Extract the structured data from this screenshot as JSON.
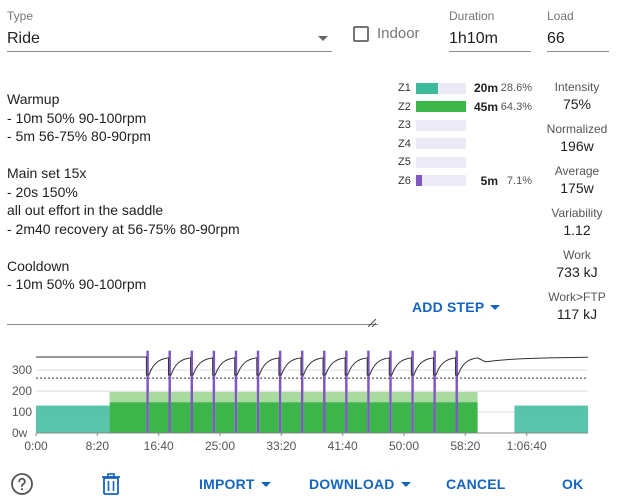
{
  "type_field": {
    "label": "Type",
    "value": "Ride"
  },
  "indoor": {
    "label": "Indoor",
    "checked": false
  },
  "duration_field": {
    "label": "Duration",
    "value": "1h10m"
  },
  "load_field": {
    "label": "Load",
    "value": "66"
  },
  "description": {
    "lines": [
      "Warmup",
      "- 10m 50% 90-100rpm",
      "- 5m 56-75% 80-90rpm",
      "",
      "Main set 15x",
      "- 20s 150%",
      "all out effort in the saddle",
      "- 2m40 recovery at 56-75% 80-90rpm",
      "",
      "Cooldown",
      "- 10m 50% 90-100rpm"
    ]
  },
  "zones": [
    {
      "name": "Z1",
      "time": "20m",
      "pct": "28.6%",
      "fraction": 0.286,
      "color": "#3dba9c"
    },
    {
      "name": "Z2",
      "time": "45m",
      "pct": "64.3%",
      "fraction": 0.643,
      "color": "#3cb54a"
    },
    {
      "name": "Z3",
      "time": "",
      "pct": "",
      "fraction": 0,
      "color": "#e6c200"
    },
    {
      "name": "Z4",
      "time": "",
      "pct": "",
      "fraction": 0,
      "color": "#f08c00"
    },
    {
      "name": "Z5",
      "time": "",
      "pct": "",
      "fraction": 0,
      "color": "#e53935"
    },
    {
      "name": "Z6",
      "time": "5m",
      "pct": "7.1%",
      "fraction": 0.071,
      "color": "#7e57c2"
    }
  ],
  "stats": [
    {
      "label": "Intensity",
      "value": "75%"
    },
    {
      "label": "Normalized",
      "value": "196w"
    },
    {
      "label": "Average",
      "value": "175w"
    },
    {
      "label": "Variability",
      "value": "1.12"
    },
    {
      "label": "Work",
      "value": "733 kJ"
    },
    {
      "label": "Work>FTP",
      "value": "117 kJ"
    }
  ],
  "add_step_label": "ADD STEP",
  "chart_data": {
    "type": "area",
    "x_ticks": [
      "0:00",
      "8:20",
      "16:40",
      "25:00",
      "33:20",
      "41:40",
      "50:00",
      "58:20",
      "1:06:40"
    ],
    "x_range_seconds": [
      0,
      4500
    ],
    "y_ticks": [
      "0w",
      "100",
      "200",
      "300"
    ],
    "ylim": [
      0,
      420
    ],
    "ftp_line": 262,
    "segments": [
      {
        "start": 0,
        "end": 600,
        "low": 131,
        "high": 131,
        "zone": "Z1"
      },
      {
        "start": 600,
        "end": 900,
        "low": 147,
        "high": 196,
        "zone": "Z2"
      },
      {
        "repeat": 15,
        "start": 900,
        "interval": [
          20,
          160
        ],
        "on_power": 393,
        "off_low": 147,
        "off_high": 196
      },
      {
        "start": 3900,
        "end": 4500,
        "low": 131,
        "high": 131,
        "zone": "Z1"
      }
    ],
    "colors": {
      "z1": "#3dba9c",
      "z2": "#3cb54a",
      "z2_light": "#a9dba0",
      "z6": "#7e57c2",
      "line": "#333333"
    }
  },
  "footer": {
    "import_label": "IMPORT",
    "download_label": "DOWNLOAD",
    "cancel_label": "CANCEL",
    "ok_label": "OK"
  }
}
